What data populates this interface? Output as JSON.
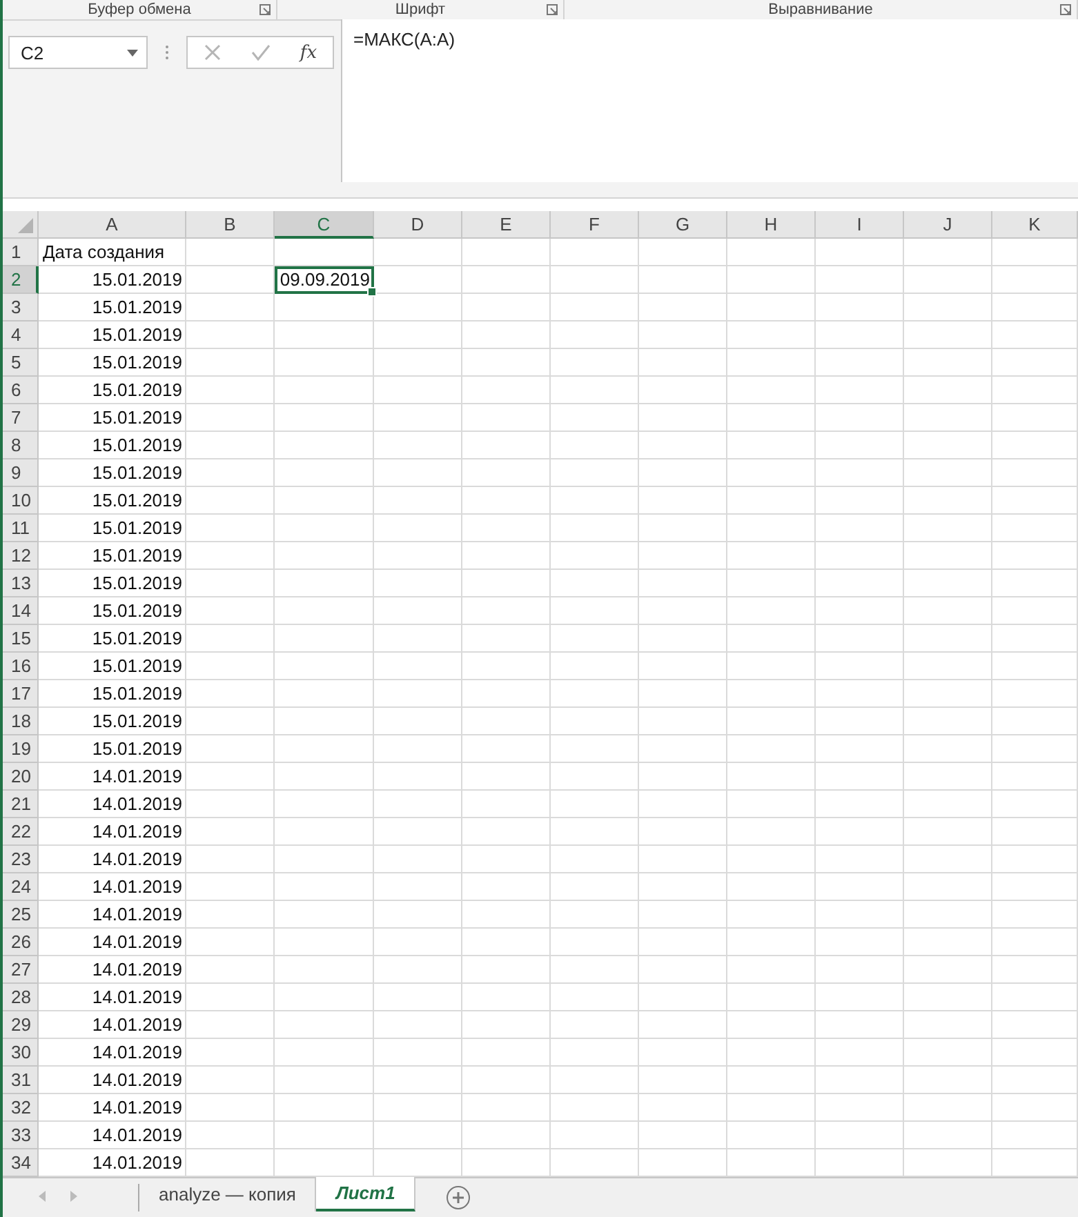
{
  "ribbon_groups": [
    {
      "label": "Буфер обмена"
    },
    {
      "label": "Шрифт"
    },
    {
      "label": "Выравнивание"
    }
  ],
  "name_box": "C2",
  "formula_buttons": [
    {
      "kind": "cancel",
      "disabled": true
    },
    {
      "kind": "enter",
      "disabled": true
    },
    {
      "kind": "function",
      "label": "fx",
      "disabled": false
    }
  ],
  "formula": "=МАКС(A:A)",
  "columns": [
    {
      "label": "A",
      "selected": false
    },
    {
      "label": "B",
      "selected": false
    },
    {
      "label": "C",
      "selected": true
    },
    {
      "label": "D",
      "selected": false
    },
    {
      "label": "E",
      "selected": false
    },
    {
      "label": "F",
      "selected": false
    },
    {
      "label": "G",
      "selected": false
    },
    {
      "label": "H",
      "selected": false
    },
    {
      "label": "I",
      "selected": false
    },
    {
      "label": "J",
      "selected": false
    },
    {
      "label": "K",
      "selected": false
    }
  ],
  "rows": [
    {
      "number": "1",
      "selected": false,
      "a": {
        "text": "Дата создания",
        "kind": "text"
      }
    },
    {
      "number": "2",
      "selected": true,
      "a": {
        "text": "15.01.2019",
        "kind": "date"
      },
      "c": {
        "text": "09.09.2019",
        "kind": "date",
        "selected": true
      }
    },
    {
      "number": "3",
      "selected": false,
      "a": {
        "text": "15.01.2019",
        "kind": "date"
      }
    },
    {
      "number": "4",
      "selected": false,
      "a": {
        "text": "15.01.2019",
        "kind": "date"
      }
    },
    {
      "number": "5",
      "selected": false,
      "a": {
        "text": "15.01.2019",
        "kind": "date"
      }
    },
    {
      "number": "6",
      "selected": false,
      "a": {
        "text": "15.01.2019",
        "kind": "date"
      }
    },
    {
      "number": "7",
      "selected": false,
      "a": {
        "text": "15.01.2019",
        "kind": "date"
      }
    },
    {
      "number": "8",
      "selected": false,
      "a": {
        "text": "15.01.2019",
        "kind": "date"
      }
    },
    {
      "number": "9",
      "selected": false,
      "a": {
        "text": "15.01.2019",
        "kind": "date"
      }
    },
    {
      "number": "10",
      "selected": false,
      "a": {
        "text": "15.01.2019",
        "kind": "date"
      }
    },
    {
      "number": "11",
      "selected": false,
      "a": {
        "text": "15.01.2019",
        "kind": "date"
      }
    },
    {
      "number": "12",
      "selected": false,
      "a": {
        "text": "15.01.2019",
        "kind": "date"
      }
    },
    {
      "number": "13",
      "selected": false,
      "a": {
        "text": "15.01.2019",
        "kind": "date"
      }
    },
    {
      "number": "14",
      "selected": false,
      "a": {
        "text": "15.01.2019",
        "kind": "date"
      }
    },
    {
      "number": "15",
      "selected": false,
      "a": {
        "text": "15.01.2019",
        "kind": "date"
      }
    },
    {
      "number": "16",
      "selected": false,
      "a": {
        "text": "15.01.2019",
        "kind": "date"
      }
    },
    {
      "number": "17",
      "selected": false,
      "a": {
        "text": "15.01.2019",
        "kind": "date"
      }
    },
    {
      "number": "18",
      "selected": false,
      "a": {
        "text": "15.01.2019",
        "kind": "date"
      }
    },
    {
      "number": "19",
      "selected": false,
      "a": {
        "text": "15.01.2019",
        "kind": "date"
      }
    },
    {
      "number": "20",
      "selected": false,
      "a": {
        "text": "14.01.2019",
        "kind": "date"
      }
    },
    {
      "number": "21",
      "selected": false,
      "a": {
        "text": "14.01.2019",
        "kind": "date"
      }
    },
    {
      "number": "22",
      "selected": false,
      "a": {
        "text": "14.01.2019",
        "kind": "date"
      }
    },
    {
      "number": "23",
      "selected": false,
      "a": {
        "text": "14.01.2019",
        "kind": "date"
      }
    },
    {
      "number": "24",
      "selected": false,
      "a": {
        "text": "14.01.2019",
        "kind": "date"
      }
    },
    {
      "number": "25",
      "selected": false,
      "a": {
        "text": "14.01.2019",
        "kind": "date"
      }
    },
    {
      "number": "26",
      "selected": false,
      "a": {
        "text": "14.01.2019",
        "kind": "date"
      }
    },
    {
      "number": "27",
      "selected": false,
      "a": {
        "text": "14.01.2019",
        "kind": "date"
      }
    },
    {
      "number": "28",
      "selected": false,
      "a": {
        "text": "14.01.2019",
        "kind": "date"
      }
    },
    {
      "number": "29",
      "selected": false,
      "a": {
        "text": "14.01.2019",
        "kind": "date"
      }
    },
    {
      "number": "30",
      "selected": false,
      "a": {
        "text": "14.01.2019",
        "kind": "date"
      }
    },
    {
      "number": "31",
      "selected": false,
      "a": {
        "text": "14.01.2019",
        "kind": "date"
      }
    },
    {
      "number": "32",
      "selected": false,
      "a": {
        "text": "14.01.2019",
        "kind": "date"
      }
    },
    {
      "number": "33",
      "selected": false,
      "a": {
        "text": "14.01.2019",
        "kind": "date"
      }
    },
    {
      "number": "34",
      "selected": false,
      "a": {
        "text": "14.01.2019",
        "kind": "date"
      }
    }
  ],
  "sheet_tabs": [
    {
      "label": "analyze — копия",
      "selected": false
    },
    {
      "label": "Лист1",
      "selected": true
    }
  ]
}
